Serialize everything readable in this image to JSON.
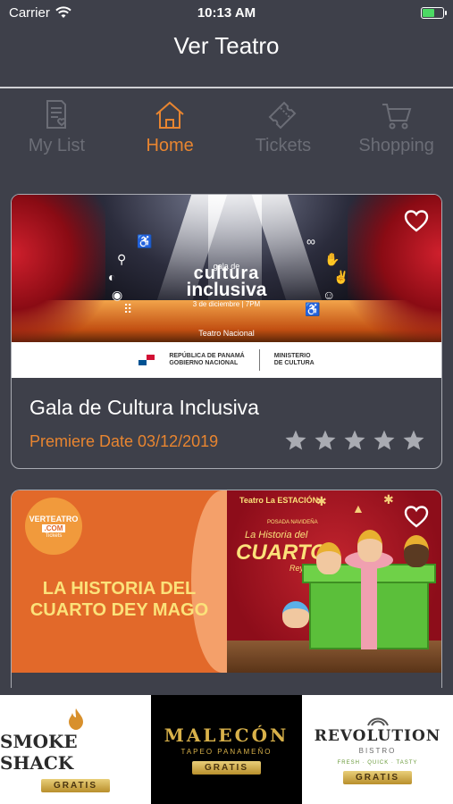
{
  "status_bar": {
    "carrier": "Carrier",
    "time": "10:13 AM",
    "battery_level": 0.6
  },
  "nav": {
    "title": "Ver Teatro"
  },
  "tabs": [
    {
      "label": "My List",
      "icon": "list-icon",
      "active": false
    },
    {
      "label": "Home",
      "icon": "home-icon",
      "active": true
    },
    {
      "label": "Tickets",
      "icon": "ticket-icon",
      "active": false
    },
    {
      "label": "Shopping",
      "icon": "cart-icon",
      "active": false
    }
  ],
  "events": [
    {
      "title": "Gala de Cultura Inclusiva",
      "premiere": "Premiere Date 03/12/2019",
      "rating": 0,
      "max_rating": 5,
      "favorite": false,
      "poster": {
        "small_line": "gala de",
        "big_line1": "cultura",
        "big_line2": "inclusiva",
        "date_line": "3 de diciembre | 7PM",
        "venue": "Teatro Nacional",
        "gov_left_line1": "REPÚBLICA DE PANAMÁ",
        "gov_left_line2": "GOBIERNO NACIONAL",
        "gov_right_line1": "MINISTERIO",
        "gov_right_line2": "DE CULTURA"
      }
    },
    {
      "favorite": false,
      "poster": {
        "badge_line1": "VERTEATRO",
        "badge_line2": ".COM",
        "badge_line3": "Tickets",
        "title": "LA HISTORIA DEL CUARTO DEY MAGO",
        "brand": "Teatro La ESTACIÓN",
        "right_small": "POSADA NAVIDEÑA",
        "right_t1": "La Historia del",
        "right_t2": "CUARTO",
        "right_t3": "Rey Mago"
      }
    }
  ],
  "ads": [
    {
      "name": "SMOKE SHACK",
      "badge": "GRATIS"
    },
    {
      "name": "MALECÓN",
      "subtitle": "TAPEO PANAMEÑO",
      "badge": "GRATIS"
    },
    {
      "name": "REVOLUTION",
      "subtitle": "BISTRO",
      "tagline": "FRESH · QUICK · TASTY",
      "badge": "GRATIS"
    }
  ],
  "colors": {
    "background": "#3e404a",
    "accent": "#e88530",
    "inactive_tab": "#6b6d76",
    "star": "#a9abb2"
  }
}
